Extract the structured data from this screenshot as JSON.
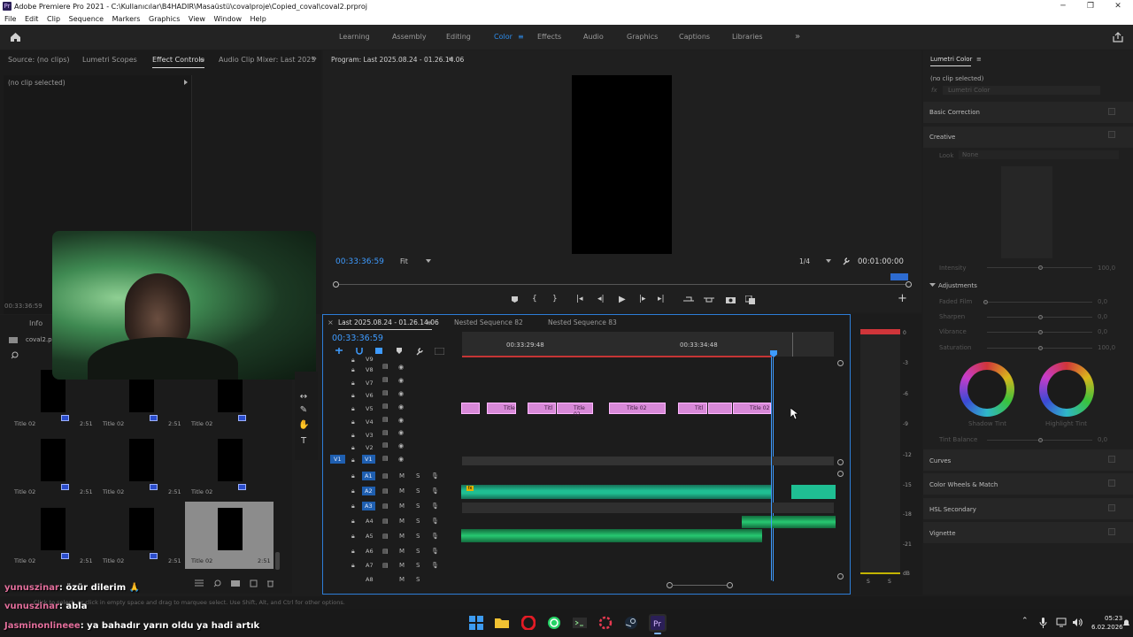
{
  "window": {
    "app_badge": "Pr",
    "title": "Adobe Premiere Pro 2021 - C:\\Kullanıcılar\\B4HADIR\\Masaüstü\\covalproje\\Copied_coval\\coval2.prproj",
    "minimize": "─",
    "restore": "❐",
    "close": "✕"
  },
  "menu": [
    "File",
    "Edit",
    "Clip",
    "Sequence",
    "Markers",
    "Graphics",
    "View",
    "Window",
    "Help"
  ],
  "workspaces": {
    "items": [
      "Learning",
      "Assembly",
      "Editing",
      "Color",
      "Effects",
      "Audio",
      "Graphics",
      "Captions",
      "Libraries"
    ],
    "active": "Color",
    "menu_icon": "≡",
    "more": "»"
  },
  "source_panel": {
    "tabs": [
      "Source: (no clips)",
      "Lumetri Scopes",
      "Effect Controls",
      "Audio Clip Mixer: Last 2025"
    ],
    "active_tab": "Effect Controls",
    "no_clip": "(no clip selected)",
    "timecode": "00:33:36:59",
    "more": "»"
  },
  "project_panel": {
    "tab_info": "Info",
    "project_name": "coval2.pr",
    "items": [
      {
        "name": "Title 02",
        "duration": "2:51"
      },
      {
        "name": "Title 02",
        "duration": "2:51"
      },
      {
        "name": "Title 02",
        "duration": ""
      },
      {
        "name": "Title 02",
        "duration": "2:51"
      },
      {
        "name": "Title 02",
        "duration": "2:51"
      },
      {
        "name": "Title 02",
        "duration": ""
      },
      {
        "name": "Title 02",
        "duration": "2:51"
      },
      {
        "name": "Title 02",
        "duration": "2:51"
      },
      {
        "name": "Title 02",
        "duration": "2:51"
      }
    ]
  },
  "program": {
    "title": "Program: Last 2025.08.24 - 01.26.14.06",
    "menu_icon": "≡",
    "timecode": "00:33:36:59",
    "fit": "Fit",
    "resolution": "1/4",
    "duration": "00:01:00:00",
    "plus": "+"
  },
  "timeline": {
    "tabs": [
      "Last 2025.08.24 - 01.26.14.06",
      "Nested Sequence 82",
      "Nested Sequence 83"
    ],
    "active_tab": "Last 2025.08.24 - 01.26.14.06",
    "close": "×",
    "menu_icon": "≡",
    "timecode": "00:33:36:59",
    "ruler": [
      "00:33:29:48",
      "00:33:34:48"
    ],
    "video_tracks": [
      "V9",
      "V8",
      "V7",
      "V6",
      "V5",
      "V4",
      "V3",
      "V2",
      "V1"
    ],
    "source_patch": "V1",
    "audio_tracks": [
      "A1",
      "A2",
      "A3",
      "A4",
      "A5",
      "A6",
      "A7",
      "A8"
    ],
    "track_m": "M",
    "track_s": "S",
    "clips": [
      "",
      "Title",
      "Titl",
      "Title 02",
      "Title 02",
      "Titl",
      "",
      "Title 02"
    ],
    "audio_badge": "fx"
  },
  "meter": {
    "scale": [
      "0",
      "-3",
      "-6",
      "-9",
      "-12",
      "-15",
      "-18",
      "-21",
      "dB"
    ],
    "solo": [
      "S",
      "S"
    ]
  },
  "lumetri": {
    "title": "Lumetri Color",
    "menu_icon": "≡",
    "no_clip": "(no clip selected)",
    "fx": "fx",
    "effect_name": "Lumetri Color",
    "sections": [
      "Basic Correction",
      "Creative",
      "Curves",
      "Color Wheels & Match",
      "HSL Secondary",
      "Vignette"
    ],
    "look_label": "Look",
    "look_value": "None",
    "creative_sliders": [
      {
        "label": "Intensity",
        "value": "100,0"
      }
    ],
    "adjustments": "Adjustments",
    "adjustment_sliders": [
      {
        "label": "Faded Film",
        "value": "0,0"
      },
      {
        "label": "Sharpen",
        "value": "0,0"
      },
      {
        "label": "Vibrance",
        "value": "0,0"
      },
      {
        "label": "Saturation",
        "value": "100,0"
      }
    ],
    "wheel_labels": [
      "Shadow Tint",
      "Highlight Tint"
    ],
    "tint_balance": {
      "label": "Tint Balance",
      "value": "0,0"
    }
  },
  "status_bar": "Click to select, or click in empty space and drag to marquee select. Use Shift, Alt, and Ctrl for other options.",
  "chat": [
    {
      "user": "yunuszinar",
      "message": ": özür dilerim 🙏"
    },
    {
      "user": "yunuszinar",
      "message": ": abla"
    },
    {
      "user": "Jasminonlineee",
      "message": ": ya bahadır yarın oldu ya hadi artık"
    }
  ],
  "tray": {
    "time": "05:23",
    "date": "6.02.2026",
    "chevron": "⌃"
  },
  "colors": {
    "accent": "#2d8ceb",
    "title_clip": "#d889d8",
    "audio_clip": "#1fbf93",
    "playhead": "#3e9bff",
    "meter_peak": "#d0353a"
  }
}
